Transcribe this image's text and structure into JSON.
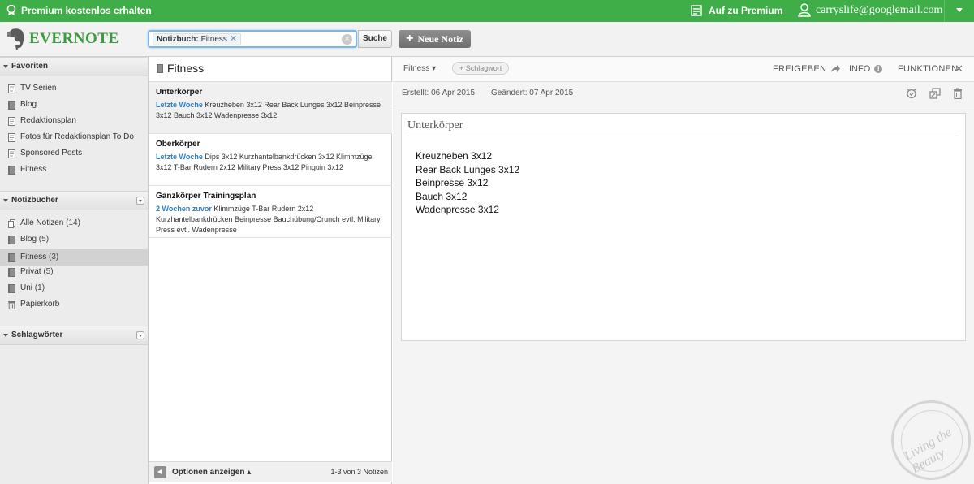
{
  "topbar": {
    "promo": "Premium kostenlos erhalten",
    "upgrade": "Auf zu Premium",
    "user_email": "carryslife@googlemail.com",
    "color": "#3fae49"
  },
  "header": {
    "logo_text": "EVERNOTE",
    "search_token_key": "Notizbuch:",
    "search_token_value": "Fitness",
    "search_token_remove": "✕",
    "search_button": "Suche",
    "new_note_button": "Neue Notiz"
  },
  "sidebar": {
    "favorites_title": "Favoriten",
    "favorites": [
      {
        "label": "TV Serien",
        "icon": "note-icon"
      },
      {
        "label": "Blog",
        "icon": "notebook-icon"
      },
      {
        "label": "Redaktionsplan",
        "icon": "note-icon"
      },
      {
        "label": "Fotos für Redaktionsplan To Do",
        "icon": "note-icon"
      },
      {
        "label": "Sponsored Posts",
        "icon": "note-icon"
      },
      {
        "label": "Fitness",
        "icon": "notebook-icon"
      }
    ],
    "notebooks_title": "Notizbücher",
    "notebooks": [
      {
        "label": "Alle Notizen",
        "count": "(14)",
        "icon": "all-notes-icon"
      },
      {
        "label": "Blog",
        "count": "(5)",
        "icon": "notebook-icon"
      },
      {
        "label": "Fitness",
        "count": "(3)",
        "icon": "notebook-icon"
      },
      {
        "label": "Privat",
        "count": "(5)",
        "icon": "notebook-icon"
      },
      {
        "label": "Uni",
        "count": "(1)",
        "icon": "notebook-icon"
      },
      {
        "label": "Papierkorb",
        "count": "",
        "icon": "trash-icon"
      }
    ],
    "tags_title": "Schlagwörter"
  },
  "notelist": {
    "title": "Fitness",
    "notes": [
      {
        "title": "Unterkörper",
        "date": "Letzte Woche",
        "snippet": "Kreuzheben 3x12 Rear Back Lunges 3x12 Beinpresse 3x12 Bauch 3x12 Wadenpresse 3x12"
      },
      {
        "title": "Oberkörper",
        "date": "Letzte Woche",
        "snippet": "Dips 3x12 Kurzhantelbankdrücken 3x12 Klimmzüge 3x12 T-Bar Rudern 2x12 Military Press 3x12 Pinguin 3x12"
      },
      {
        "title": "Ganzkörper Trainingsplan",
        "date": "2 Wochen zuvor",
        "snippet": "Klimmzüge T-Bar Rudern 2x12 Kurzhantelbankdrücken Beinpresse Bauchübung/Crunch evtl. Military Press evtl. Wadenpresse"
      }
    ],
    "footer_options": "Optionen anzeigen",
    "footer_count": "1-3 von 3 Notizen"
  },
  "editor": {
    "notebook": "Fitness",
    "tag_button": "+ Schlagwort",
    "share": "FREIGEBEN",
    "info": "INFO",
    "functions": "FUNKTIONEN",
    "close": "✕",
    "created": "Erstellt: 06 Apr 2015",
    "changed": "Geändert: 07 Apr 2015",
    "note_title": "Unterkörper",
    "lines": [
      "Kreuzheben 3x12",
      "Rear Back Lunges 3x12",
      "Beinpresse 3x12",
      "Bauch 3x12",
      "Wadenpresse 3x12"
    ]
  },
  "watermark": {
    "text": "Living the Beauty"
  }
}
